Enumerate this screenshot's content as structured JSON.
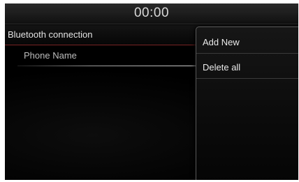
{
  "status_bar": {
    "clock": "00:00"
  },
  "header": {
    "title": "Bluetooth connection"
  },
  "devices": [
    {
      "label": "Phone Name"
    }
  ],
  "popup_menu": {
    "items": [
      {
        "label": "Add New"
      },
      {
        "label": "Delete all"
      }
    ]
  },
  "colors": {
    "accent_line": "#7a2424",
    "background": "#000000",
    "text": "#e4e4e4"
  }
}
